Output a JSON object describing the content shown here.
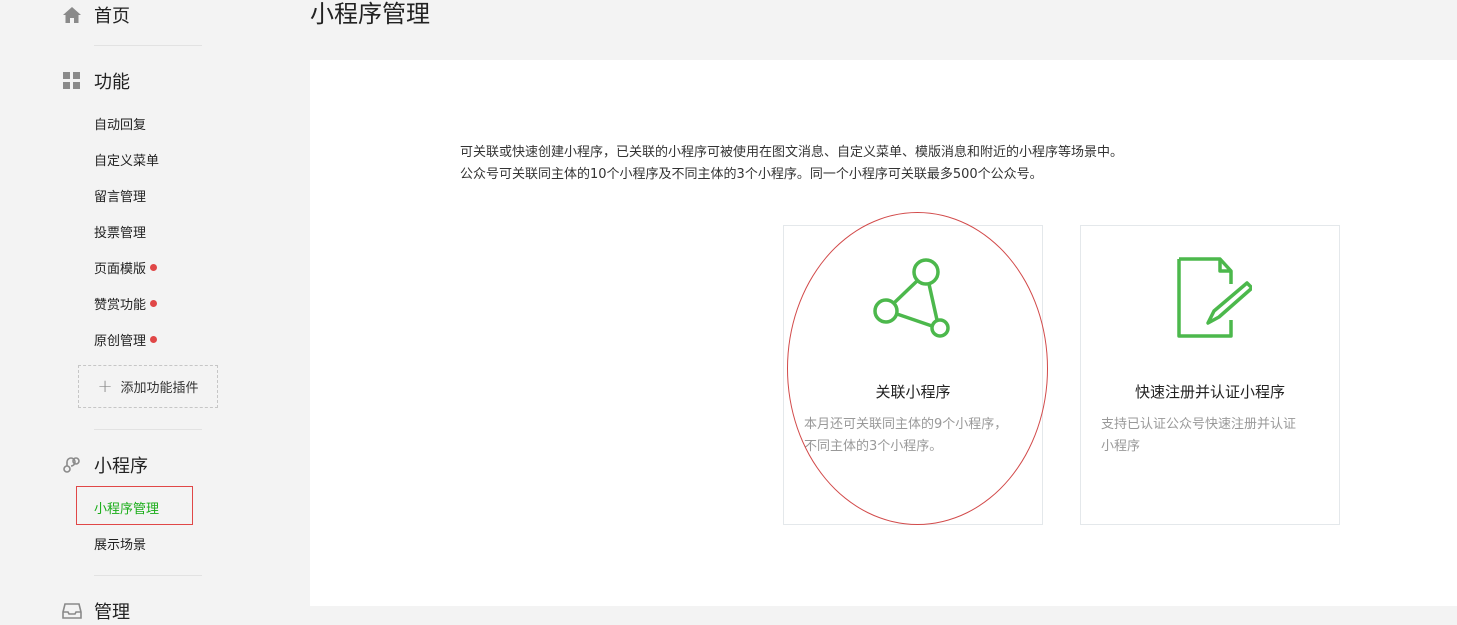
{
  "sidebar": {
    "home": {
      "label": "首页",
      "icon": "home-icon"
    },
    "features": {
      "label": "功能",
      "icon": "grid-icon",
      "items": [
        {
          "label": "自动回复",
          "dot": false
        },
        {
          "label": "自定义菜单",
          "dot": false
        },
        {
          "label": "留言管理",
          "dot": false
        },
        {
          "label": "投票管理",
          "dot": false
        },
        {
          "label": "页面模版",
          "dot": true
        },
        {
          "label": "赞赏功能",
          "dot": true
        },
        {
          "label": "原创管理",
          "dot": true
        }
      ],
      "add_plugin": "添加功能插件"
    },
    "miniprogram": {
      "label": "小程序",
      "icon": "link-icon",
      "items": [
        {
          "label": "小程序管理",
          "active": true
        },
        {
          "label": "展示场景",
          "active": false
        }
      ]
    },
    "manage": {
      "label": "管理",
      "icon": "inbox-icon"
    }
  },
  "page": {
    "title": "小程序管理",
    "description": [
      "可关联或快速创建小程序，已关联的小程序可被使用在图文消息、自定义菜单、模版消息和附近的小程序等场景中。",
      "公众号可关联同主体的10个小程序及不同主体的3个小程序。同一个小程序可关联最多500个公众号。"
    ],
    "cards": [
      {
        "title": "关联小程序",
        "icon": "network-nodes-icon",
        "desc": [
          "本月还可关联同主体的9个小程序，",
          "不同主体的3个小程序。"
        ]
      },
      {
        "title": "快速注册并认证小程序",
        "icon": "document-edit-icon",
        "desc": [
          "支持已认证公众号快速注册并认证",
          "小程序"
        ]
      }
    ]
  },
  "colors": {
    "accent_green": "#1aad19",
    "icon_green": "#4cb84c",
    "dot_red": "#e04747",
    "annotation_red": "#d24a4a"
  }
}
